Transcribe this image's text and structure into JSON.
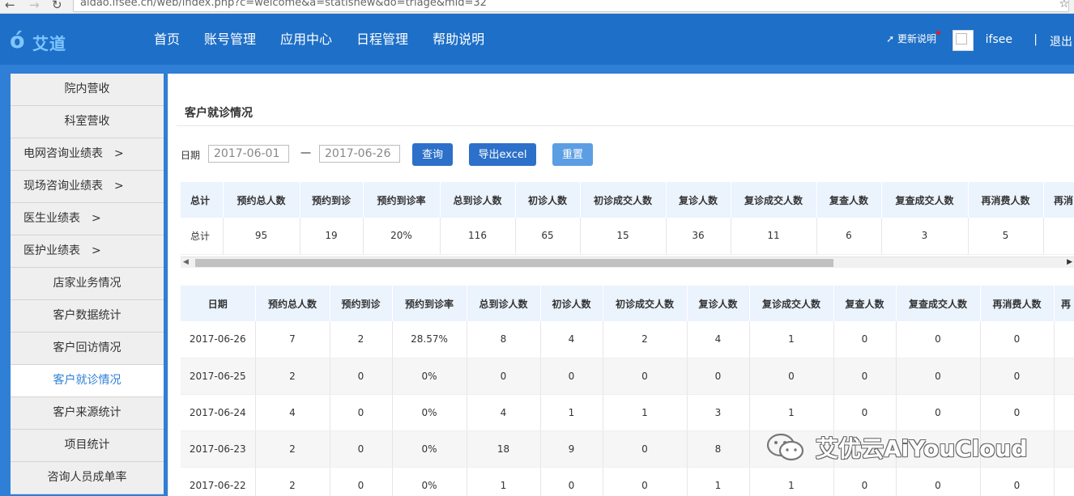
{
  "browser": {
    "url": "aidao.ifsee.cn/web/index.php?c=welcome&a=statisnew&do=triage&mid=32"
  },
  "header": {
    "logo_text": "艾道",
    "nav": [
      "首页",
      "账号管理",
      "应用中心",
      "日程管理",
      "帮助说明"
    ],
    "update_label": "更新说明",
    "username": "ifsee",
    "separator": "|",
    "logout": "退出"
  },
  "sidebar": {
    "items": [
      {
        "label": "院内营收",
        "arrow": ""
      },
      {
        "label": "科室营收",
        "arrow": ""
      },
      {
        "label": "电网咨询业绩表",
        "arrow": ">"
      },
      {
        "label": "现场咨询业绩表",
        "arrow": ">"
      },
      {
        "label": "医生业绩表",
        "arrow": ">"
      },
      {
        "label": "医护业绩表",
        "arrow": ">"
      },
      {
        "label": "店家业务情况",
        "arrow": ""
      },
      {
        "label": "客户数据统计",
        "arrow": ""
      },
      {
        "label": "客户回访情况",
        "arrow": ""
      },
      {
        "label": "客户就诊情况",
        "arrow": "",
        "active": true
      },
      {
        "label": "客户来源统计",
        "arrow": ""
      },
      {
        "label": "项目统计",
        "arrow": ""
      },
      {
        "label": "咨询人员成单率",
        "arrow": ""
      }
    ]
  },
  "page": {
    "title": "客户就诊情况"
  },
  "filter": {
    "date_label": "日期",
    "start": "2017-06-01",
    "separator": "一",
    "end": "2017-06-26",
    "query": "查询",
    "export": "导出excel",
    "reset": "重置"
  },
  "summary": {
    "headers": [
      "总计",
      "预约总人数",
      "预约到诊",
      "预约到诊率",
      "总到诊人数",
      "初诊人数",
      "初诊成交人数",
      "复诊人数",
      "复诊成交人数",
      "复查人数",
      "复查成交人数",
      "再消费人数",
      "再消"
    ],
    "row": [
      "总计",
      "95",
      "19",
      "20%",
      "116",
      "65",
      "15",
      "36",
      "11",
      "6",
      "3",
      "5",
      ""
    ]
  },
  "detail": {
    "headers": [
      "日期",
      "预约总人数",
      "预约到诊",
      "预约到诊率",
      "总到诊人数",
      "初诊人数",
      "初诊成交人数",
      "复诊人数",
      "复诊成交人数",
      "复查人数",
      "复查成交人数",
      "再消费人数",
      "再"
    ],
    "rows": [
      [
        "2017-06-26",
        "7",
        "2",
        "28.57%",
        "8",
        "4",
        "2",
        "4",
        "1",
        "0",
        "0",
        "0",
        ""
      ],
      [
        "2017-06-25",
        "2",
        "0",
        "0%",
        "0",
        "0",
        "0",
        "0",
        "0",
        "0",
        "0",
        "0",
        ""
      ],
      [
        "2017-06-24",
        "4",
        "0",
        "0%",
        "4",
        "1",
        "1",
        "3",
        "1",
        "0",
        "0",
        "0",
        ""
      ],
      [
        "2017-06-23",
        "2",
        "0",
        "0%",
        "18",
        "9",
        "0",
        "8",
        "",
        "",
        "",
        "",
        ""
      ],
      [
        "2017-06-22",
        "2",
        "0",
        "0%",
        "1",
        "0",
        "0",
        "1",
        "1",
        "0",
        "0",
        "0",
        ""
      ]
    ]
  },
  "watermark": {
    "text": "艾优云AiYouCloud"
  },
  "colors": {
    "brand": "#1e6fc7",
    "button": "#2c70c9",
    "button_light": "#5c9ee3",
    "active_text": "#2d7fd8"
  }
}
